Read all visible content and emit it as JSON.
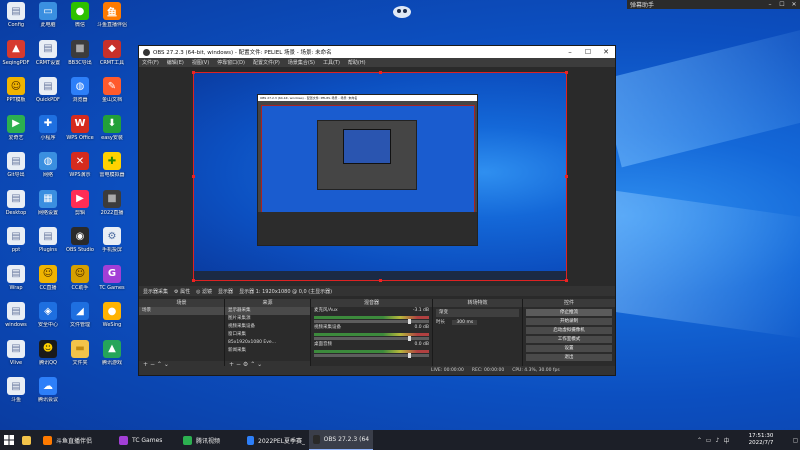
{
  "topbar": {
    "title": "弹幕助手"
  },
  "desktop_icons": [
    {
      "label": "Config",
      "color": "#e9eef5",
      "glyph": "▤",
      "fg": "#6a7aa0"
    },
    {
      "label": "此电脑",
      "color": "#3a8fe0",
      "glyph": "▭",
      "fg": "#fff"
    },
    {
      "label": "微信",
      "color": "#2dc100",
      "glyph": "●",
      "fg": "#fff"
    },
    {
      "label": "斗鱼直播伴侣",
      "color": "#ff7a00",
      "glyph": "鱼",
      "fg": "#fff"
    },
    {
      "label": "SeqingPDF",
      "color": "#d63a2f",
      "glyph": "▲",
      "fg": "#fff"
    },
    {
      "label": "CRMT设置",
      "color": "#e9eef5",
      "glyph": "▤",
      "fg": "#6a7aa0"
    },
    {
      "label": "BB3C导出",
      "color": "#3c3c3c",
      "glyph": "■",
      "fg": "#aaa"
    },
    {
      "label": "CRMT工具",
      "color": "#c7302a",
      "glyph": "◆",
      "fg": "#fff"
    },
    {
      "label": "PPT模板",
      "color": "#f0b400",
      "glyph": "☺",
      "fg": "#4a2a00"
    },
    {
      "label": "QuickPDF",
      "color": "#e9eef5",
      "glyph": "▤",
      "fg": "#6a7aa0"
    },
    {
      "label": "浏览器",
      "color": "#2d7ff9",
      "glyph": "◍",
      "fg": "#fff"
    },
    {
      "label": "金山文档",
      "color": "#ff5a2d",
      "glyph": "✎",
      "fg": "#fff"
    },
    {
      "label": "爱奇艺",
      "color": "#2cb050",
      "glyph": "▶",
      "fg": "#fff"
    },
    {
      "label": "小程序",
      "color": "#1e6fe0",
      "glyph": "✚",
      "fg": "#fff"
    },
    {
      "label": "WPS Office",
      "color": "#d52b1e",
      "glyph": "W",
      "fg": "#fff"
    },
    {
      "label": "easy安装",
      "color": "#22a03a",
      "glyph": "⬇",
      "fg": "#fff"
    },
    {
      "label": "Git导出",
      "color": "#e9eef5",
      "glyph": "▤",
      "fg": "#6a7aa0"
    },
    {
      "label": "网络",
      "color": "#3a8fe0",
      "glyph": "◍",
      "fg": "#fff"
    },
    {
      "label": "WPS演示",
      "color": "#d52b1e",
      "glyph": "✕",
      "fg": "#fff"
    },
    {
      "label": "雷电模拟器",
      "color": "#ffd200",
      "glyph": "✚",
      "fg": "#2a8a00"
    },
    {
      "label": "Desktop",
      "color": "#e9eef5",
      "glyph": "▤",
      "fg": "#6a7aa0"
    },
    {
      "label": "网络设置",
      "color": "#3a8fe0",
      "glyph": "▦",
      "fg": "#fff"
    },
    {
      "label": "剪辑",
      "color": "#ff2d55",
      "glyph": "▶",
      "fg": "#fff"
    },
    {
      "label": "2022直播",
      "color": "#3c3c3c",
      "glyph": "■",
      "fg": "#aaa"
    },
    {
      "label": "ppt",
      "color": "#e9eef5",
      "glyph": "▤",
      "fg": "#6a7aa0"
    },
    {
      "label": "Plugins",
      "color": "#e9eef5",
      "glyph": "▤",
      "fg": "#6a7aa0"
    },
    {
      "label": "OBS Studio",
      "color": "#2a2a2a",
      "glyph": "◉",
      "fg": "#fff"
    },
    {
      "label": "手机投屏",
      "color": "#e9eef5",
      "glyph": "⚙",
      "fg": "#4a6aa0"
    },
    {
      "label": "Wrap",
      "color": "#e9eef5",
      "glyph": "▤",
      "fg": "#6a7aa0"
    },
    {
      "label": "CC直播",
      "color": "#f0b400",
      "glyph": "☺",
      "fg": "#4a2a00"
    },
    {
      "label": "CC助手",
      "color": "#d6a000",
      "glyph": "☺",
      "fg": "#4a2a00"
    },
    {
      "label": "TC Games",
      "color": "#a23fd6",
      "glyph": "G",
      "fg": "#fff"
    },
    {
      "label": "windows",
      "color": "#e9eef5",
      "glyph": "▤",
      "fg": "#6a7aa0"
    },
    {
      "label": "安全中心",
      "color": "#1e6fe0",
      "glyph": "◈",
      "fg": "#fff"
    },
    {
      "label": "文件管理",
      "color": "#1e6fe0",
      "glyph": "◢",
      "fg": "#fff"
    },
    {
      "label": "WeSing",
      "color": "#ffb300",
      "glyph": "●",
      "fg": "#fff"
    },
    {
      "label": "Vlive",
      "color": "#e9eef5",
      "glyph": "▤",
      "fg": "#6a7aa0"
    },
    {
      "label": "腾讯QQ",
      "color": "#1a1a1a",
      "glyph": "☻",
      "fg": "#ffd000"
    },
    {
      "label": "文件夹",
      "color": "#f3c34a",
      "glyph": "▬",
      "fg": "#c28a10"
    },
    {
      "label": "腾讯游戏",
      "color": "#25a55a",
      "glyph": "▲",
      "fg": "#fff"
    },
    {
      "label": "斗鱼",
      "color": "#e9eef5",
      "glyph": "▤",
      "fg": "#6a7aa0"
    },
    {
      "label": "腾讯会议",
      "color": "#2d7ff9",
      "glyph": "☁",
      "fg": "#fff"
    }
  ],
  "obs": {
    "title": "OBS 27.2.3 (64-bit, windows) - 配置文件: PELIEL 场景 - 场景: 未命名",
    "menu": [
      "文件(F)",
      "编辑(E)",
      "视图(V)",
      "停靠窗口(D)",
      "配置文件(P)",
      "场景集合(S)",
      "工具(T)",
      "帮助(H)"
    ],
    "control_row": [
      "显示器采集",
      "⚙ 属性",
      "◎ 滤镜",
      "显示器",
      "显示器 1: 1920x1080 @ 0,0 (主显示器)"
    ],
    "docks": {
      "scenes": {
        "header": "场景",
        "items": [
          "场景"
        ]
      },
      "sources": {
        "header": "来源",
        "items": [
          "显示器采集",
          "图片采集源",
          "视频采集设备",
          "窗口采集",
          "85x1920x1080 Eve...",
          "新闻采集"
        ]
      },
      "mixer": {
        "header": "混音器",
        "channels": [
          {
            "name": "麦克风/Aux",
            "db": "-3.1 dB"
          },
          {
            "name": "视频采集设备",
            "db": "0.0 dB"
          },
          {
            "name": "桌面音频",
            "db": "0.0 dB"
          }
        ]
      },
      "transitions": {
        "header": "转场特效",
        "type": "渐变",
        "duration_label": "时长",
        "duration": "300 ms"
      },
      "controls": {
        "header": "控件",
        "buttons": [
          "停止推流",
          "开始录制",
          "启动虚拟摄像机",
          "工作室模式",
          "设置",
          "退出"
        ]
      }
    },
    "status": {
      "live": "LIVE: 00:00:00",
      "rec": "REC: 00:00:00",
      "cpu": "CPU: 4.3%, 30.00 fps"
    }
  },
  "taskbar": {
    "items": [
      {
        "label": "斗鱼直播伴侣",
        "color": "#ff7a00"
      },
      {
        "label": "TC Games",
        "color": "#a23fd6"
      },
      {
        "label": "腾讯视频",
        "color": "#2cb050"
      },
      {
        "label": "2022PEL夏季赛_PE...",
        "color": "#2d7ff9"
      },
      {
        "label": "OBS 27.2.3 (64-bit...",
        "color": "#2a2a2a"
      }
    ],
    "time": "17:51:30",
    "date": "2022/7/7"
  }
}
